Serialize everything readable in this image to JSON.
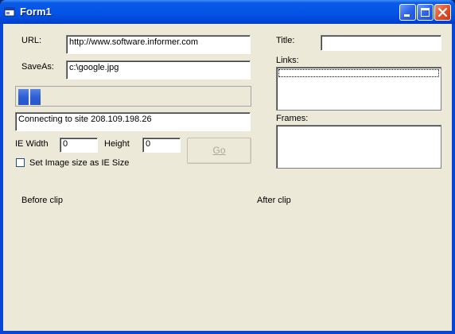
{
  "window": {
    "title": "Form1",
    "icon": "app-icon",
    "controls": [
      "minimize-icon",
      "maximize-icon",
      "close-icon"
    ]
  },
  "form": {
    "url_label": "URL:",
    "url_value": "http://www.software.informer.com",
    "saveas_label": "SaveAs:",
    "saveas_value": "c:\\google.jpg",
    "progress_fraction": 0.1,
    "status_value": "Connecting to site 208.109.198.26",
    "ie_width_label": "IE Width",
    "ie_width_value": "0",
    "height_label": "Height",
    "height_value": "0",
    "go_label": "Go",
    "checkbox_label": "Set Image size as IE Size",
    "checkbox_checked": false,
    "title_label": "Title:",
    "title_value": "",
    "links_label": "Links:",
    "frames_label": "Frames:",
    "before_clip_label": "Before clip",
    "after_clip_label": "After clip"
  },
  "colors": {
    "title_bar": "#0453e6",
    "client_bg": "#ece9d8",
    "progress_fill": "#2c5fd5",
    "disabled_text": "#aca899"
  }
}
